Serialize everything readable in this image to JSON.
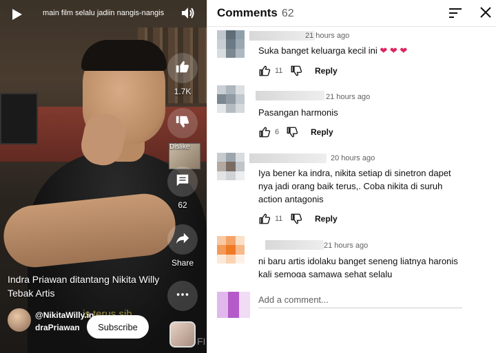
{
  "video": {
    "top_title": "main film selalu jadiin nangis-nangis",
    "like_count": "1.7K",
    "dislike_label": "Dislike",
    "comment_count": "62",
    "share_label": "Share",
    "caption": "Indra Priawan ditantang Nikita Willy Tebak Artis",
    "subtitle_ghost": "is terus sih",
    "channel_name": "@NikitaWilly.indraPriawan",
    "subscribe_label": "Subscribe",
    "corner_mark": "FI",
    "icons": [
      "play-icon",
      "volume-icon",
      "like-icon",
      "dislike-icon",
      "comment-icon",
      "share-icon",
      "more-icon"
    ]
  },
  "comments_panel": {
    "title": "Comments",
    "count": "62",
    "icons": [
      "sort-icon",
      "close-icon"
    ],
    "items": [
      {
        "time": "21 hours ago",
        "text": "Suka banget keluarga kecil ini ❤️ ❤️ ❤️",
        "likes": "11",
        "reply_label": "Reply",
        "avatar_colors": [
          "#bfc6cd",
          "#5e6d78",
          "#8fa0ab",
          "#c8ced4",
          "#6b7a84",
          "#9aa7b1",
          "#d7dce0",
          "#7b8891",
          "#aeb8c0"
        ]
      },
      {
        "time": "21 hours ago",
        "text": "Pasangan harmonis",
        "likes": "6",
        "reply_label": "Reply",
        "avatar_colors": [
          "#c9cfd4",
          "#adb6bd",
          "#dcdfe2",
          "#7b8791",
          "#8f9aa3",
          "#c1c8cd",
          "#e3e6e8",
          "#b4bcc2",
          "#d5d9dc"
        ]
      },
      {
        "time": "20 hours ago",
        "text": "Iya bener ka indra, nikita setiap di sinetron dapet nya jadi orang baik terus,. Coba nikita di suruh action antagonis",
        "likes": "11",
        "reply_label": "Reply",
        "avatar_colors": [
          "#c6cbd0",
          "#9ea6ad",
          "#d9dcdf",
          "#b3a9a0",
          "#7a6c63",
          "#c0c5c9",
          "#e1e3e5",
          "#cfd3d6",
          "#eceeef"
        ]
      },
      {
        "time": "21 hours ago",
        "text": "ni baru artis idolaku banget seneng liatnya haronis kali semoga samawa sehat selalu",
        "likes": "",
        "reply_label": "",
        "avatar_colors": [
          "#f8c9a3",
          "#f4a366",
          "#fbe0c8",
          "#f29a5a",
          "#ee7a25",
          "#f6b98a",
          "#fce9d8",
          "#f9d3b2",
          "#fdf1e6"
        ]
      }
    ],
    "add_comment_placeholder": "Add a comment...",
    "add_avatar_colors": [
      "#e1b8ec",
      "#b55bc9",
      "#f0dcf5"
    ]
  }
}
